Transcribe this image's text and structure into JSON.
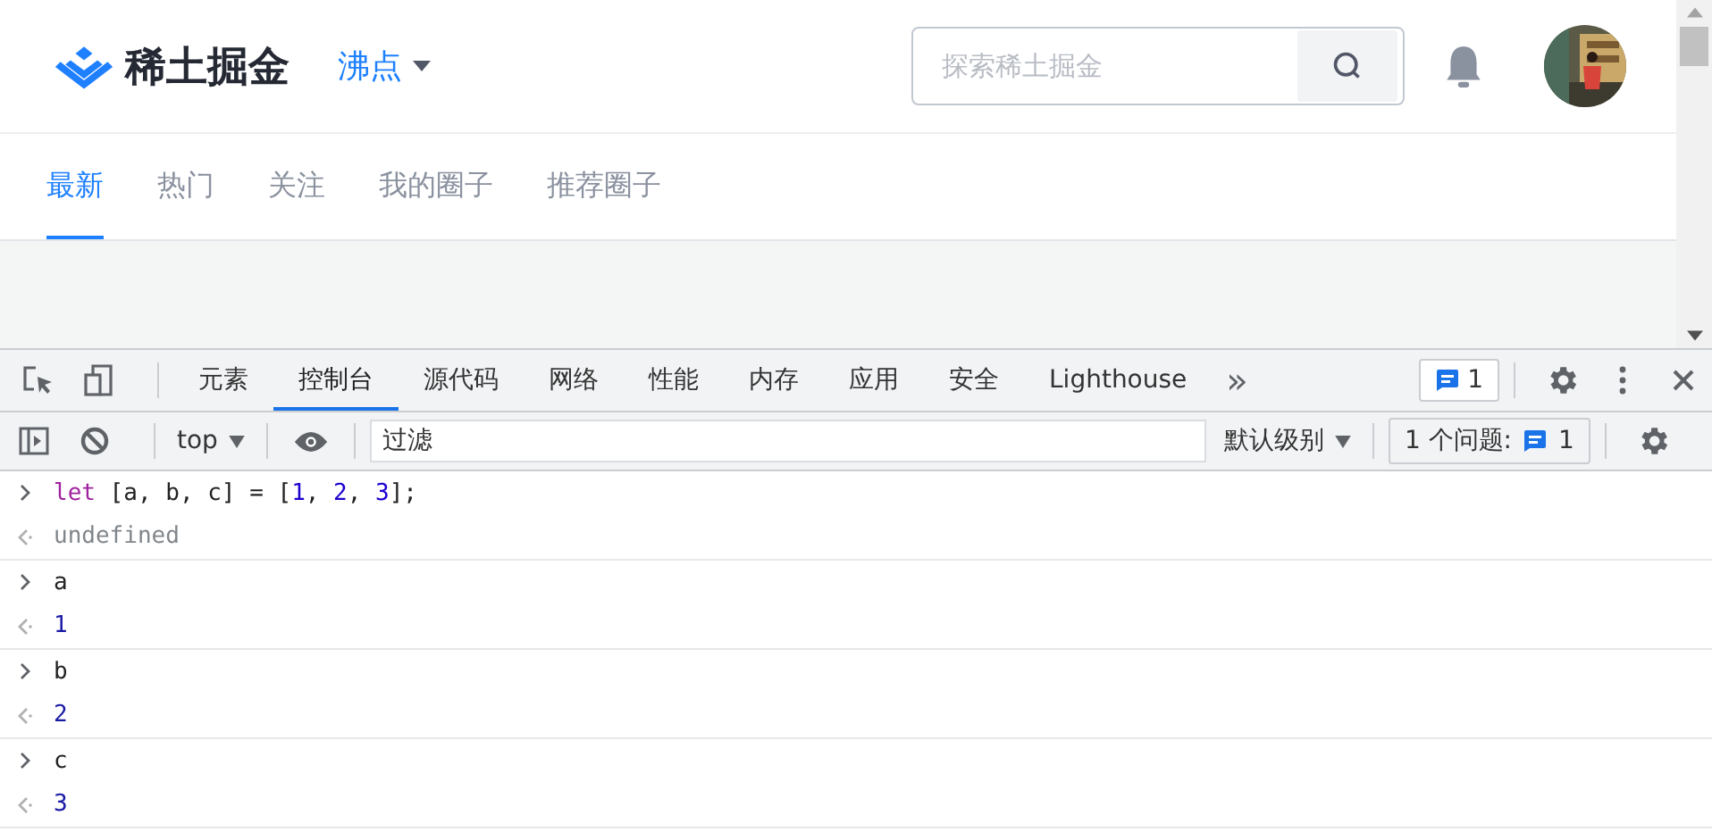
{
  "site": {
    "logo": "稀土掘金",
    "menu": "沸点",
    "search": {
      "placeholder": "探索稀土掘金"
    },
    "tabs": [
      {
        "label": "最新",
        "selected": true
      },
      {
        "label": "热门",
        "selected": false
      },
      {
        "label": "关注",
        "selected": false
      },
      {
        "label": "我的圈子",
        "selected": false
      },
      {
        "label": "推荐圈子",
        "selected": false
      }
    ]
  },
  "devtools": {
    "tabs": [
      {
        "label": "元素",
        "selected": false
      },
      {
        "label": "控制台",
        "selected": true
      },
      {
        "label": "源代码",
        "selected": false
      },
      {
        "label": "网络",
        "selected": false
      },
      {
        "label": "性能",
        "selected": false
      },
      {
        "label": "内存",
        "selected": false
      },
      {
        "label": "应用",
        "selected": false
      },
      {
        "label": "安全",
        "selected": false
      },
      {
        "label": "Lighthouse",
        "selected": false
      }
    ],
    "more": "»",
    "issues_badge": "1",
    "toolbar": {
      "context": "top",
      "filter": {
        "placeholder": "过滤"
      },
      "levels": "默认级别",
      "issues_label": "1 个问题:",
      "issues_count": "1"
    },
    "console": [
      {
        "input": [
          {
            "kind": "keyword",
            "text": "let"
          },
          {
            "kind": "plain",
            "text": " [a, b, c] = ["
          },
          {
            "kind": "number",
            "text": "1"
          },
          {
            "kind": "plain",
            "text": ", "
          },
          {
            "kind": "number",
            "text": "2"
          },
          {
            "kind": "plain",
            "text": ", "
          },
          {
            "kind": "number",
            "text": "3"
          },
          {
            "kind": "plain",
            "text": "];"
          }
        ],
        "output": {
          "kind": "undefined",
          "text": "undefined"
        }
      },
      {
        "input": [
          {
            "kind": "plain",
            "text": "a"
          }
        ],
        "output": {
          "kind": "number",
          "text": "1"
        }
      },
      {
        "input": [
          {
            "kind": "plain",
            "text": "b"
          }
        ],
        "output": {
          "kind": "number",
          "text": "2"
        }
      },
      {
        "input": [
          {
            "kind": "plain",
            "text": "c"
          }
        ],
        "output": {
          "kind": "number",
          "text": "3"
        }
      }
    ]
  }
}
